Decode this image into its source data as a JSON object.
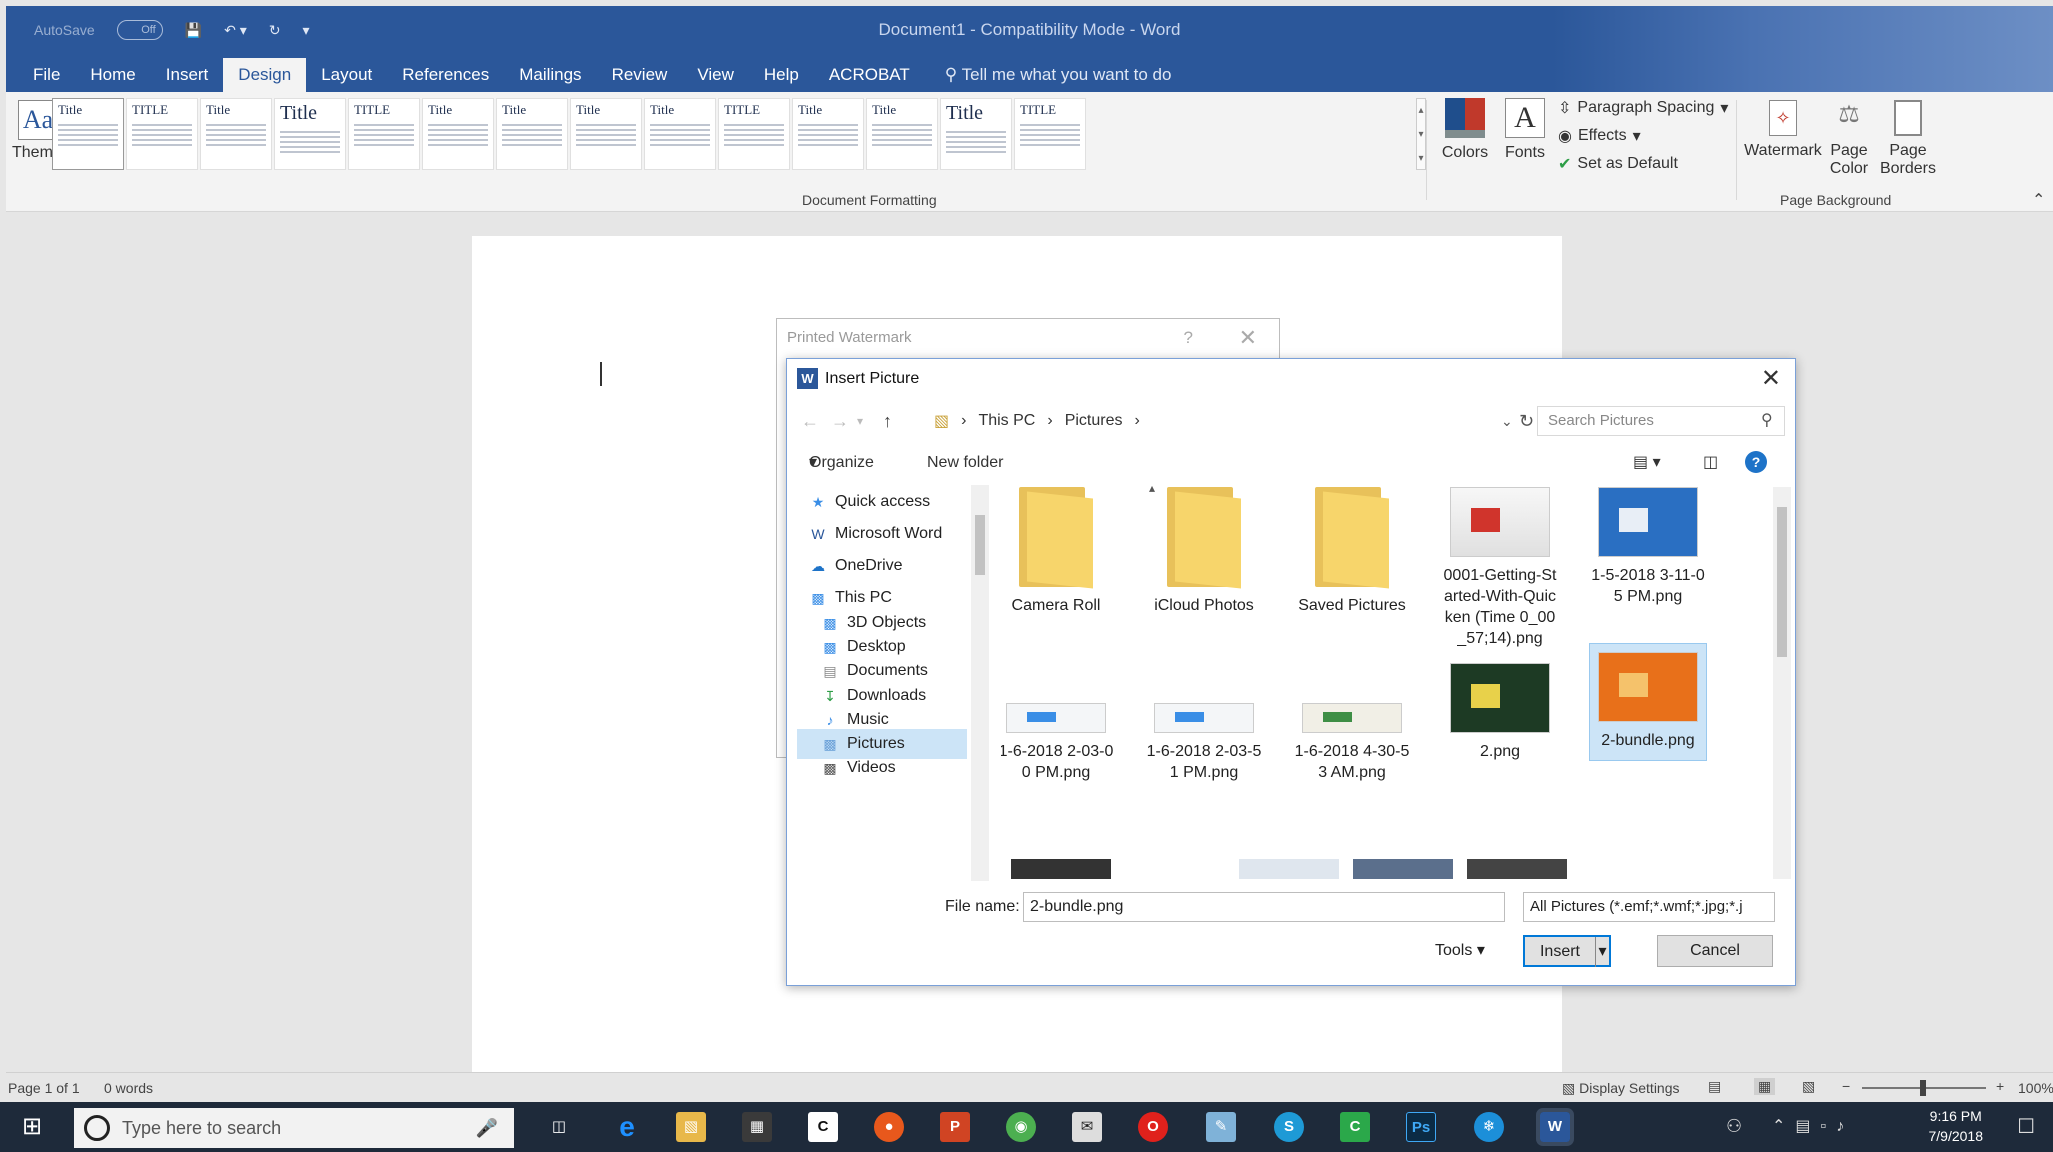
{
  "window": {
    "title": "Document1  -  Compatibility Mode  -  Word"
  },
  "qat": {
    "autosave": "AutoSave",
    "autosave_state": "Off"
  },
  "tabs": [
    "File",
    "Home",
    "Insert",
    "Design",
    "Layout",
    "References",
    "Mailings",
    "Review",
    "View",
    "Help",
    "ACROBAT"
  ],
  "tellme": "Tell me what you want to do",
  "ribbon": {
    "themes": "Themes",
    "style_titles": [
      "Title",
      "TITLE",
      "Title",
      "Title",
      "TITLE",
      "Title",
      "Title",
      "Title",
      "Title",
      "TITLE",
      "Title",
      "Title",
      "Title",
      "TITLE"
    ],
    "colors": "Colors",
    "fonts": "Fonts",
    "paragraph_spacing": "Paragraph Spacing",
    "effects": "Effects",
    "set_default": "Set as Default",
    "group_doc_formatting": "Document Formatting",
    "watermark": "Watermark",
    "page_color_1": "Page",
    "page_color_2": "Color",
    "page_borders_1": "Page",
    "page_borders_2": "Borders",
    "group_page_background": "Page Background"
  },
  "printed_watermark": {
    "title": "Printed Watermark",
    "help": "?"
  },
  "insert_picture": {
    "title": "Insert Picture",
    "path": [
      "This PC",
      "Pictures"
    ],
    "search_placeholder": "Search Pictures",
    "organize": "Organize",
    "new_folder": "New folder",
    "nav": [
      {
        "label": "Quick access",
        "icon": "star-icon"
      },
      {
        "label": "Microsoft Word",
        "icon": "word-icon"
      },
      {
        "label": "OneDrive",
        "icon": "cloud-icon"
      },
      {
        "label": "This PC",
        "icon": "pc-icon"
      },
      {
        "label": "3D Objects",
        "icon": "cube-icon"
      },
      {
        "label": "Desktop",
        "icon": "desktop-icon"
      },
      {
        "label": "Documents",
        "icon": "document-icon"
      },
      {
        "label": "Downloads",
        "icon": "download-icon"
      },
      {
        "label": "Music",
        "icon": "music-icon"
      },
      {
        "label": "Pictures",
        "icon": "pictures-icon"
      },
      {
        "label": "Videos",
        "icon": "video-icon"
      }
    ],
    "files": [
      {
        "name": "Camera Roll"
      },
      {
        "name": "iCloud Photos"
      },
      {
        "name": "Saved Pictures"
      },
      {
        "name": "0001-Getting-Started-With-Quicken (Time 0_00_57;14).png"
      },
      {
        "name": "1-5-2018 3-11-05 PM.png"
      },
      {
        "name": "1-6-2018 2-03-00 PM.png"
      },
      {
        "name": "1-6-2018 2-03-51 PM.png"
      },
      {
        "name": "1-6-2018 4-30-53 AM.png"
      },
      {
        "name": "2.png"
      },
      {
        "name": "2-bundle.png"
      }
    ],
    "file_name_label": "File name:",
    "file_name_value": "2-bundle.png",
    "filter": "All Pictures (*.emf;*.wmf;*.jpg;*.j",
    "tools": "Tools",
    "insert": "Insert",
    "cancel": "Cancel"
  },
  "status": {
    "page": "Page 1 of 1",
    "words": "0 words",
    "display_settings": "Display Settings",
    "zoom": "100%"
  },
  "taskbar": {
    "search_placeholder": "Type here to search",
    "time": "9:16 PM",
    "date": "7/9/2018"
  }
}
